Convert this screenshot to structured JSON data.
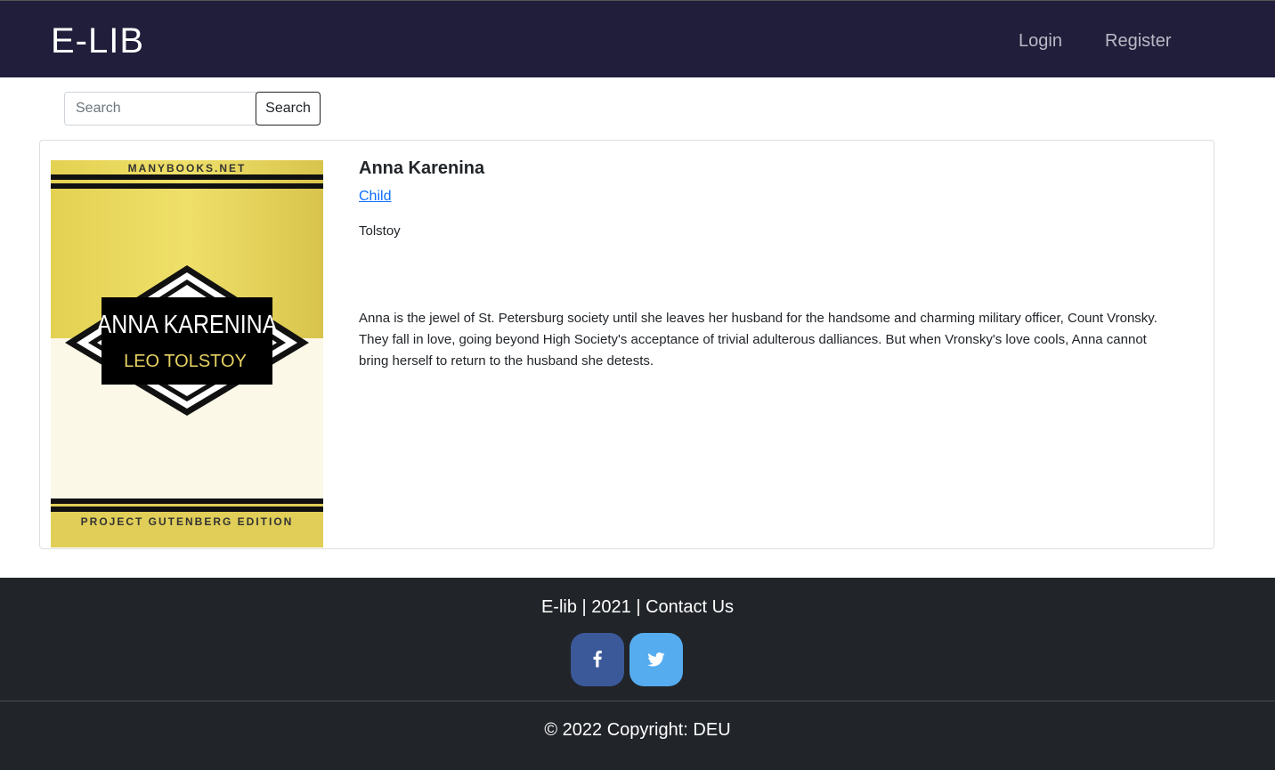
{
  "header": {
    "brand": "E-LIB",
    "nav": {
      "login": "Login",
      "register": "Register"
    }
  },
  "search": {
    "placeholder": "Search",
    "button_label": "Search"
  },
  "book": {
    "title": "Anna Karenina",
    "category": "Child",
    "author": "Tolstoy",
    "description": "Anna is the jewel of St. Petersburg society until she leaves her husband for the handsome and charming military officer, Count Vronsky. They fall in love, going beyond High Society's acceptance of trivial adulterous dalliances. But when Vronsky's love cools, Anna cannot bring herself to return to the husband she detests.",
    "cover": {
      "publisher_top": "MANYBOOKS.NET",
      "cover_title": "ANNA KARENINA",
      "cover_author": "LEO TOLSTOY",
      "edition": "PROJECT GUTENBERG EDITION"
    }
  },
  "footer": {
    "links_line": "E-lib | 2021 | Contact Us",
    "social": [
      {
        "name": "facebook",
        "icon": "facebook-icon",
        "color": "#3b5998"
      },
      {
        "name": "twitter",
        "icon": "twitter-icon",
        "color": "#55acee"
      }
    ],
    "copyright": "© 2022 Copyright: DEU"
  },
  "colors": {
    "navbar": "#201e3a",
    "footer": "#212429",
    "link": "#0d6efd"
  }
}
